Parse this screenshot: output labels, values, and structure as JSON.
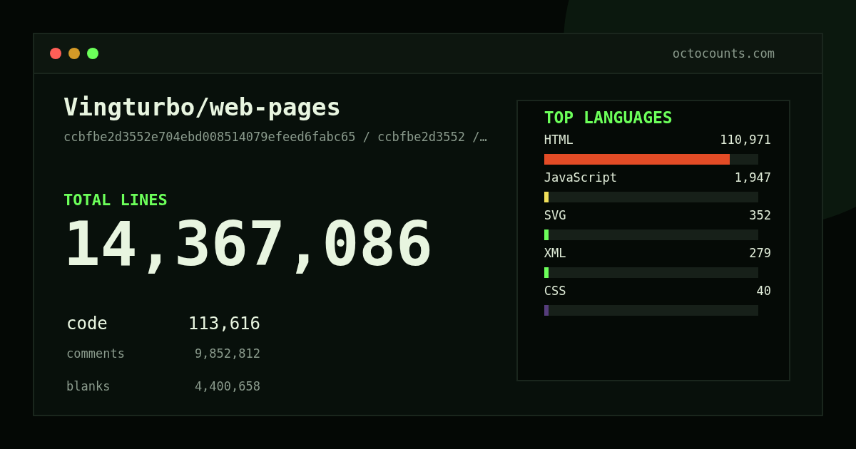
{
  "window": {
    "url": "octocounts.com"
  },
  "repo": {
    "name": "Vingturbo/web-pages",
    "path": "ccbfbe2d3552e704ebd008514079efeed6fabc65 / ccbfbe2d3552 /…"
  },
  "total": {
    "label": "TOTAL LINES",
    "value": "14,367,086"
  },
  "stats": [
    {
      "kind": "primary",
      "label": "code",
      "value": "113,616"
    },
    {
      "kind": "secondary",
      "label": "comments",
      "value": "9,852,812"
    },
    {
      "kind": "secondary",
      "label": "blanks",
      "value": "4,400,658"
    }
  ],
  "languages": {
    "title": "TOP LANGUAGES",
    "items": [
      {
        "name": "HTML",
        "count": "110,971",
        "level": 0.867,
        "color": "#e34c26"
      },
      {
        "name": "JavaScript",
        "count": "1,947",
        "level": 0.02,
        "color": "#f1e05a"
      },
      {
        "name": "SVG",
        "count": "352",
        "level": 0.02,
        "color": "#6cff5a"
      },
      {
        "name": "XML",
        "count": "279",
        "level": 0.02,
        "color": "#6cff5a"
      },
      {
        "name": "CSS",
        "count": "40",
        "level": 0.02,
        "color": "#563d7c"
      }
    ]
  }
}
